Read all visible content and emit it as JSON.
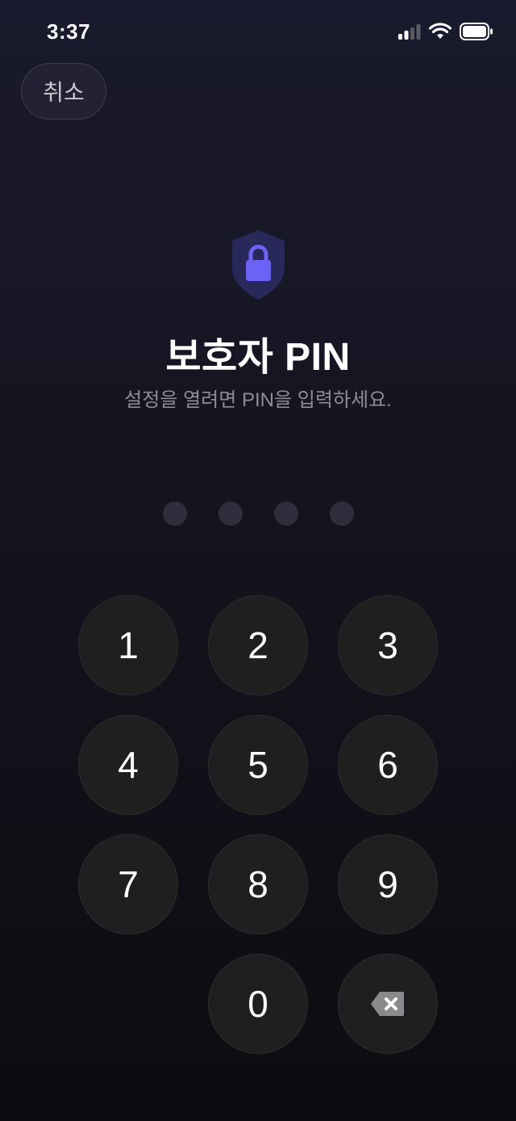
{
  "status_bar": {
    "time": "3:37",
    "icons": [
      "cellular-signal-icon",
      "wifi-icon",
      "battery-icon"
    ]
  },
  "header": {
    "cancel_label": "취소"
  },
  "main": {
    "icon": "shield-lock-icon",
    "title": "보호자 PIN",
    "subtitle": "설정을 열려면 PIN을 입력하세요."
  },
  "pin": {
    "length": 4,
    "entered": 0
  },
  "keypad": {
    "keys": [
      "1",
      "2",
      "3",
      "4",
      "5",
      "6",
      "7",
      "8",
      "9",
      "0"
    ],
    "backspace_icon": "backspace-icon"
  },
  "colors": {
    "accent": "#6c63f5",
    "shield": "#2a2960",
    "key_bg": "#1e1f1f",
    "dot_empty": "#2e2e3c"
  }
}
